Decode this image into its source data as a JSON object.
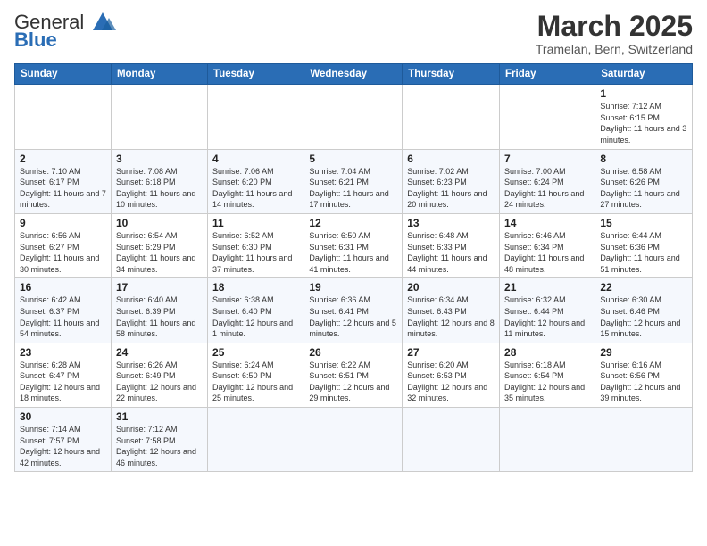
{
  "header": {
    "logo_general": "General",
    "logo_blue": "Blue",
    "month_title": "March 2025",
    "subtitle": "Tramelan, Bern, Switzerland"
  },
  "weekdays": [
    "Sunday",
    "Monday",
    "Tuesday",
    "Wednesday",
    "Thursday",
    "Friday",
    "Saturday"
  ],
  "weeks": [
    [
      {
        "day": "",
        "info": ""
      },
      {
        "day": "",
        "info": ""
      },
      {
        "day": "",
        "info": ""
      },
      {
        "day": "",
        "info": ""
      },
      {
        "day": "",
        "info": ""
      },
      {
        "day": "",
        "info": ""
      },
      {
        "day": "1",
        "info": "Sunrise: 7:12 AM\nSunset: 6:15 PM\nDaylight: 11 hours and 3 minutes."
      }
    ],
    [
      {
        "day": "2",
        "info": "Sunrise: 7:10 AM\nSunset: 6:17 PM\nDaylight: 11 hours and 7 minutes."
      },
      {
        "day": "3",
        "info": "Sunrise: 7:08 AM\nSunset: 6:18 PM\nDaylight: 11 hours and 10 minutes."
      },
      {
        "day": "4",
        "info": "Sunrise: 7:06 AM\nSunset: 6:20 PM\nDaylight: 11 hours and 14 minutes."
      },
      {
        "day": "5",
        "info": "Sunrise: 7:04 AM\nSunset: 6:21 PM\nDaylight: 11 hours and 17 minutes."
      },
      {
        "day": "6",
        "info": "Sunrise: 7:02 AM\nSunset: 6:23 PM\nDaylight: 11 hours and 20 minutes."
      },
      {
        "day": "7",
        "info": "Sunrise: 7:00 AM\nSunset: 6:24 PM\nDaylight: 11 hours and 24 minutes."
      },
      {
        "day": "8",
        "info": "Sunrise: 6:58 AM\nSunset: 6:26 PM\nDaylight: 11 hours and 27 minutes."
      }
    ],
    [
      {
        "day": "9",
        "info": "Sunrise: 6:56 AM\nSunset: 6:27 PM\nDaylight: 11 hours and 30 minutes."
      },
      {
        "day": "10",
        "info": "Sunrise: 6:54 AM\nSunset: 6:29 PM\nDaylight: 11 hours and 34 minutes."
      },
      {
        "day": "11",
        "info": "Sunrise: 6:52 AM\nSunset: 6:30 PM\nDaylight: 11 hours and 37 minutes."
      },
      {
        "day": "12",
        "info": "Sunrise: 6:50 AM\nSunset: 6:31 PM\nDaylight: 11 hours and 41 minutes."
      },
      {
        "day": "13",
        "info": "Sunrise: 6:48 AM\nSunset: 6:33 PM\nDaylight: 11 hours and 44 minutes."
      },
      {
        "day": "14",
        "info": "Sunrise: 6:46 AM\nSunset: 6:34 PM\nDaylight: 11 hours and 48 minutes."
      },
      {
        "day": "15",
        "info": "Sunrise: 6:44 AM\nSunset: 6:36 PM\nDaylight: 11 hours and 51 minutes."
      }
    ],
    [
      {
        "day": "16",
        "info": "Sunrise: 6:42 AM\nSunset: 6:37 PM\nDaylight: 11 hours and 54 minutes."
      },
      {
        "day": "17",
        "info": "Sunrise: 6:40 AM\nSunset: 6:39 PM\nDaylight: 11 hours and 58 minutes."
      },
      {
        "day": "18",
        "info": "Sunrise: 6:38 AM\nSunset: 6:40 PM\nDaylight: 12 hours and 1 minute."
      },
      {
        "day": "19",
        "info": "Sunrise: 6:36 AM\nSunset: 6:41 PM\nDaylight: 12 hours and 5 minutes."
      },
      {
        "day": "20",
        "info": "Sunrise: 6:34 AM\nSunset: 6:43 PM\nDaylight: 12 hours and 8 minutes."
      },
      {
        "day": "21",
        "info": "Sunrise: 6:32 AM\nSunset: 6:44 PM\nDaylight: 12 hours and 11 minutes."
      },
      {
        "day": "22",
        "info": "Sunrise: 6:30 AM\nSunset: 6:46 PM\nDaylight: 12 hours and 15 minutes."
      }
    ],
    [
      {
        "day": "23",
        "info": "Sunrise: 6:28 AM\nSunset: 6:47 PM\nDaylight: 12 hours and 18 minutes."
      },
      {
        "day": "24",
        "info": "Sunrise: 6:26 AM\nSunset: 6:49 PM\nDaylight: 12 hours and 22 minutes."
      },
      {
        "day": "25",
        "info": "Sunrise: 6:24 AM\nSunset: 6:50 PM\nDaylight: 12 hours and 25 minutes."
      },
      {
        "day": "26",
        "info": "Sunrise: 6:22 AM\nSunset: 6:51 PM\nDaylight: 12 hours and 29 minutes."
      },
      {
        "day": "27",
        "info": "Sunrise: 6:20 AM\nSunset: 6:53 PM\nDaylight: 12 hours and 32 minutes."
      },
      {
        "day": "28",
        "info": "Sunrise: 6:18 AM\nSunset: 6:54 PM\nDaylight: 12 hours and 35 minutes."
      },
      {
        "day": "29",
        "info": "Sunrise: 6:16 AM\nSunset: 6:56 PM\nDaylight: 12 hours and 39 minutes."
      }
    ],
    [
      {
        "day": "30",
        "info": "Sunrise: 7:14 AM\nSunset: 7:57 PM\nDaylight: 12 hours and 42 minutes."
      },
      {
        "day": "31",
        "info": "Sunrise: 7:12 AM\nSunset: 7:58 PM\nDaylight: 12 hours and 46 minutes."
      },
      {
        "day": "",
        "info": ""
      },
      {
        "day": "",
        "info": ""
      },
      {
        "day": "",
        "info": ""
      },
      {
        "day": "",
        "info": ""
      },
      {
        "day": "",
        "info": ""
      }
    ]
  ]
}
